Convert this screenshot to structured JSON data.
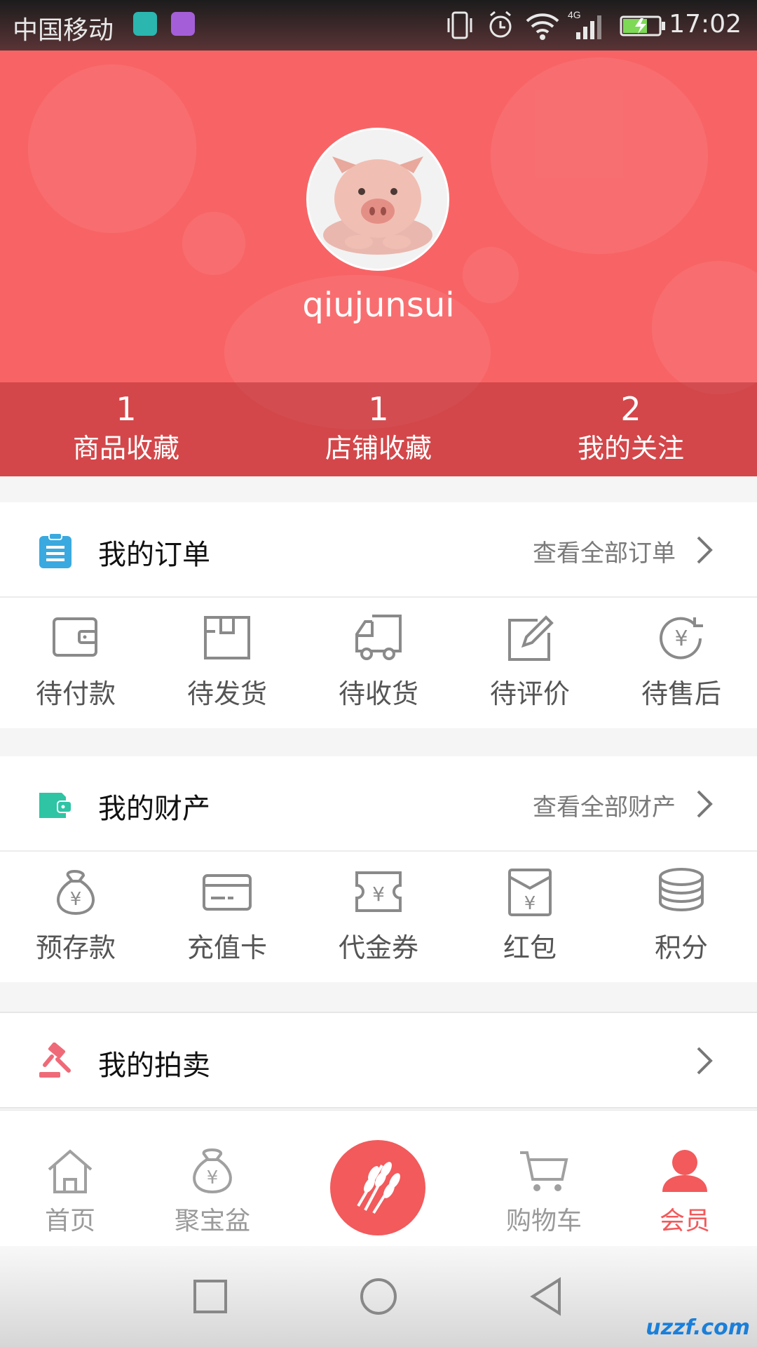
{
  "status_bar": {
    "carrier": "中国移动",
    "network": "4G",
    "time": "17:02"
  },
  "profile": {
    "username": "qiujunsui",
    "stats": [
      {
        "value": "1",
        "label": "商品收藏"
      },
      {
        "value": "1",
        "label": "店铺收藏"
      },
      {
        "value": "2",
        "label": "我的关注"
      }
    ]
  },
  "orders": {
    "title": "我的订单",
    "more": "查看全部订单",
    "items": [
      {
        "label": "待付款",
        "icon": "wallet-icon"
      },
      {
        "label": "待发货",
        "icon": "package-icon"
      },
      {
        "label": "待收货",
        "icon": "truck-icon"
      },
      {
        "label": "待评价",
        "icon": "edit-icon"
      },
      {
        "label": "待售后",
        "icon": "refund-icon"
      }
    ]
  },
  "assets": {
    "title": "我的财产",
    "more": "查看全部财产",
    "items": [
      {
        "label": "预存款",
        "icon": "money-bag-icon"
      },
      {
        "label": "充值卡",
        "icon": "card-icon"
      },
      {
        "label": "代金券",
        "icon": "coupon-icon"
      },
      {
        "label": "红包",
        "icon": "red-envelope-icon"
      },
      {
        "label": "积分",
        "icon": "coins-icon"
      }
    ]
  },
  "auction": {
    "title": "我的拍卖"
  },
  "tab_bar": {
    "items": [
      {
        "label": "首页",
        "icon": "home-icon"
      },
      {
        "label": "聚宝盆",
        "icon": "treasure-bag-icon"
      },
      {
        "label": "",
        "icon": "wheat-icon"
      },
      {
        "label": "购物车",
        "icon": "cart-icon"
      },
      {
        "label": "会员",
        "icon": "member-icon",
        "active": true
      }
    ]
  },
  "colors": {
    "brand_red": "#f25a5c",
    "header_red": "#f86466",
    "orders_icon": "#3aa9e0",
    "assets_icon": "#2fc4a4",
    "auction_icon": "#ef6a78"
  }
}
